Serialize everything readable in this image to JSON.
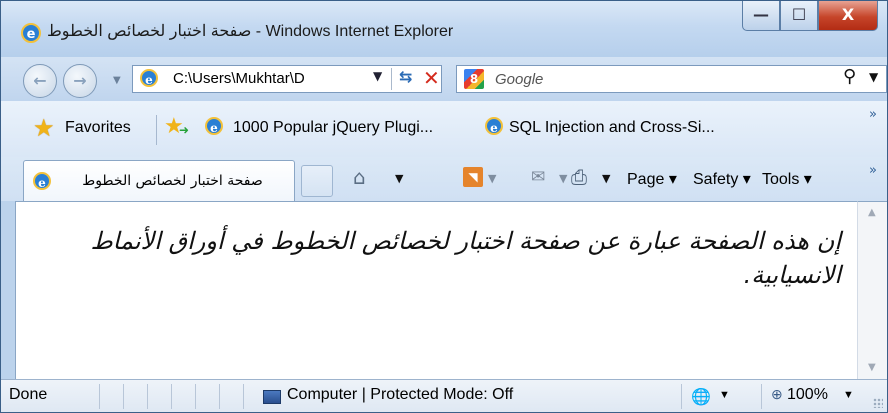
{
  "window": {
    "title": "صفحة اختبار لخصائص الخطوط - Windows Internet Explorer",
    "minimize_glyph": "—",
    "maximize_glyph": "☐",
    "close_glyph": "X"
  },
  "nav": {
    "address": "C:\\Users\\Mukhtar\\D",
    "search_placeholder": "Google"
  },
  "favorites": {
    "label": "Favorites",
    "links": [
      {
        "label": "1000 Popular jQuery Plugi..."
      },
      {
        "label": "SQL Injection and Cross-Si..."
      }
    ]
  },
  "tab": {
    "label": "صفحة اختبار لخصائص الخطوط"
  },
  "commandbar": {
    "page": "Page ▾",
    "safety": "Safety ▾",
    "tools": "Tools ▾"
  },
  "content": {
    "text": "إن هذه الصفحة عبارة عن صفحة اختبار لخصائص الخطوط في أوراق الأنماط الانسيابية."
  },
  "statusbar": {
    "status": "Done",
    "zone": "Computer | Protected Mode: Off",
    "zoom": "100%"
  },
  "icons": {
    "ie": "ie-logo-icon",
    "back": "back-arrow-icon",
    "forward": "forward-arrow-icon",
    "refresh": "refresh-icon",
    "stop": "stop-icon",
    "google": "google-icon",
    "search": "search-icon",
    "favorites": "favorites-star-icon",
    "add_favorite": "add-favorites-icon",
    "home": "home-icon",
    "feeds": "feeds-icon",
    "mail": "mail-icon",
    "print": "print-icon",
    "computer_zone": "computer-zone-icon",
    "security": "security-icon",
    "zoom": "zoom-icon"
  }
}
